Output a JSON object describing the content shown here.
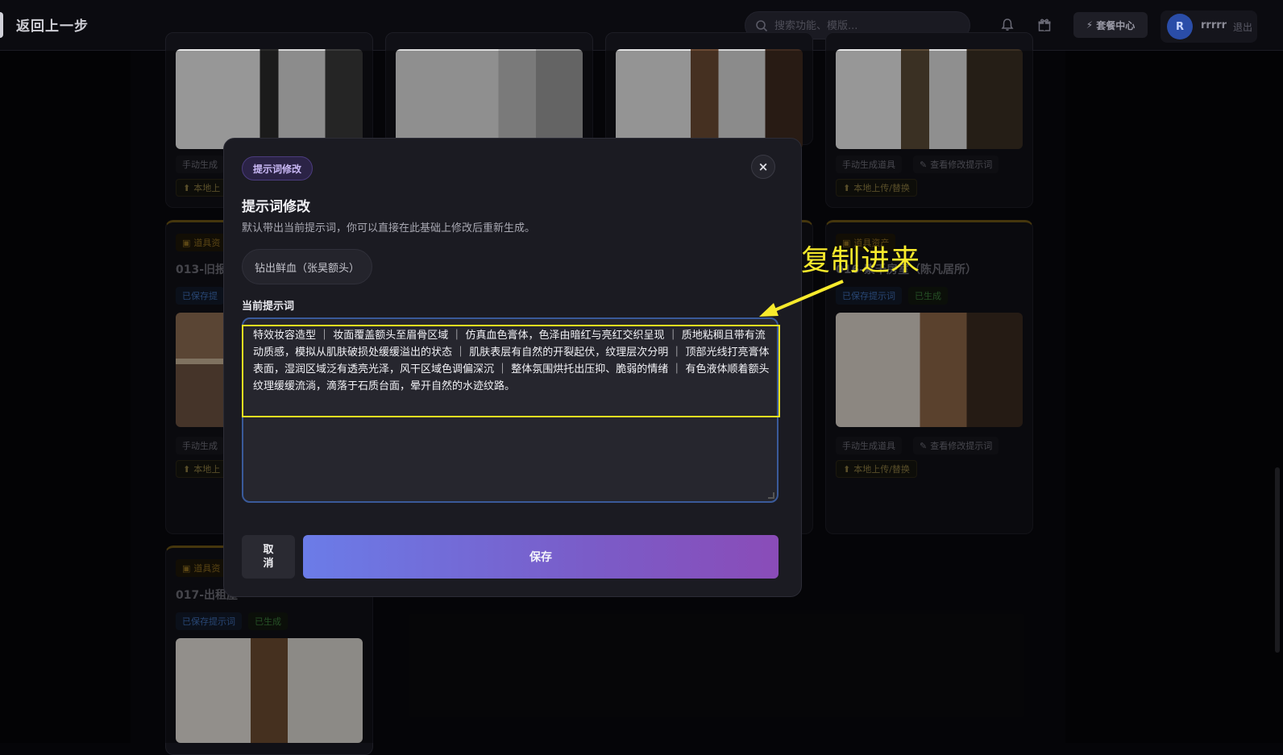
{
  "topbar": {
    "back_label": "返回上一步",
    "search_placeholder": "搜索功能、模版...",
    "plan_label": "套餐中心",
    "avatar_initial": "R",
    "username": "rrrrr",
    "logout_label": "退出"
  },
  "background_cards": {
    "manual_generate": "手动生成道具",
    "manual_generate_short": "手动生成",
    "view_prompt": "查看修改提示词",
    "upload_replace": "本地上传/替换",
    "upload_short": "本地上",
    "asset_tag": "道具资产",
    "asset_tag_short": "道具资",
    "saved_prompt": "已保存提示词",
    "saved_prompt_short": "已保存提",
    "generated": "已生成",
    "card_013_title": "013-旧报",
    "card_017_title": "017-出租屋",
    "card_016_title": "016-紫千房室（陈凡居所）"
  },
  "modal": {
    "tag": "提示词修改",
    "close": "×",
    "title": "提示词修改",
    "description": "默认带出当前提示词，你可以直接在此基础上修改后重新生成。",
    "scene_chip": "钻出鲜血（张昊额头）",
    "prompt_label": "当前提示词",
    "prompt_text": "特效妆容造型 ｜ 妆面覆盖额头至眉骨区域 ｜ 仿真血色膏体，色泽由暗红与亮红交织呈现 ｜ 质地粘稠且带有流动质感，模拟从肌肤破损处缓缓溢出的状态 ｜ 肌肤表层有自然的开裂起伏，纹理层次分明 ｜ 顶部光线打亮膏体表面，湿润区域泛有透亮光泽，风干区域色调偏深沉 ｜ 整体氛围烘托出压抑、脆弱的情绪 ｜ 有色液体顺着额头纹理缓缓流淌，滴落于石质台面，晕开自然的水迹纹路。",
    "cancel_label": "取\n消",
    "save_label": "保存"
  },
  "annotation": {
    "text": "复制进来",
    "color": "#f7ea2c"
  }
}
